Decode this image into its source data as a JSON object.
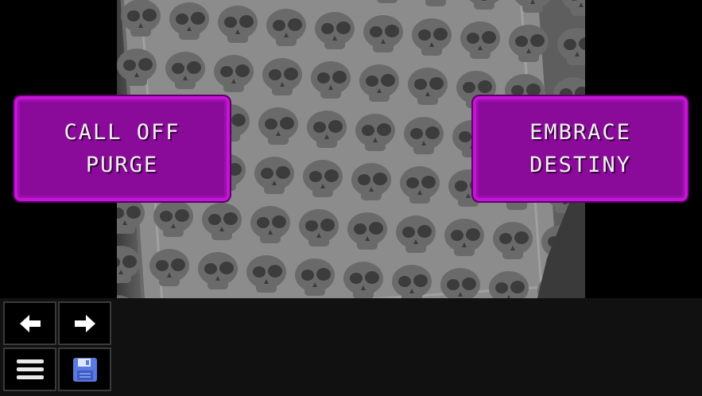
{
  "choices": {
    "left": {
      "label": "CALL OFF\nPURGE"
    },
    "right": {
      "label": "EMBRACE\nDESTINY"
    }
  },
  "toolbar": {
    "back_icon": "arrow-left-icon",
    "forward_icon": "arrow-right-icon",
    "menu_icon": "hamburger-menu-icon",
    "save_icon": "floppy-disk-save-icon"
  },
  "colors": {
    "choice_fill": "#8a0a9a",
    "choice_border": "#c514d6",
    "skull": "#6a6a6a",
    "paper": "#8c8c8c",
    "save_icon": "#5a7ae0"
  }
}
